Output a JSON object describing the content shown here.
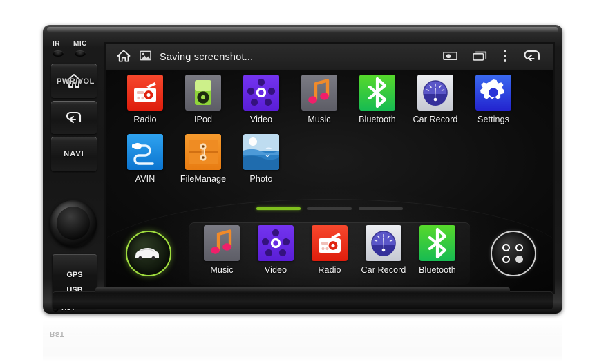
{
  "device": {
    "sensors": [
      {
        "label": "IR"
      },
      {
        "label": "MIC"
      }
    ],
    "buttons": [
      {
        "name": "home",
        "label": "",
        "icon": "home-icon"
      },
      {
        "name": "back",
        "label": "",
        "icon": "back-arrow-icon"
      },
      {
        "name": "navi",
        "label": "NAVI",
        "icon": ""
      }
    ],
    "knob_label": "PWR/VOL",
    "slot_labels": [
      "GPS",
      "USB"
    ],
    "reset_label": "RST"
  },
  "statusbar": {
    "home_icon": "home-icon",
    "notification_icon": "image-icon",
    "message": "Saving screenshot...",
    "right_icons": [
      {
        "name": "screenshot-icon"
      },
      {
        "name": "recent-apps-icon"
      },
      {
        "name": "overflow-menu-icon"
      },
      {
        "name": "back-arrow-icon"
      }
    ]
  },
  "home": {
    "apps_row1": [
      {
        "label": "Radio",
        "icon": "radio-icon",
        "color": "#ee2d1a"
      },
      {
        "label": "IPod",
        "icon": "ipod-icon",
        "color": "#6b6b73"
      },
      {
        "label": "Video",
        "icon": "video-icon",
        "color": "#6526e8"
      },
      {
        "label": "Music",
        "icon": "music-note-icon",
        "color": "#6b6b73"
      },
      {
        "label": "Bluetooth",
        "icon": "bluetooth-icon",
        "color": "#2ecc2e"
      },
      {
        "label": "Car Record",
        "icon": "gauge-icon",
        "color": "#d6d8de"
      },
      {
        "label": "Settings",
        "icon": "gear-icon",
        "color": "#2b49e0"
      }
    ],
    "apps_row2": [
      {
        "label": "AVIN",
        "icon": "avin-plug-icon",
        "color": "#1b8ae0"
      },
      {
        "label": "FileManage",
        "icon": "folder-icon",
        "color": "#ef8c23"
      },
      {
        "label": "Photo",
        "icon": "photo-icon",
        "color": "#2f84c8"
      }
    ],
    "pager": {
      "pages": 3,
      "active": 1
    },
    "dock": {
      "car_button": "car-icon",
      "apps": [
        {
          "label": "Music",
          "icon": "music-note-icon",
          "color": "#6b6b73"
        },
        {
          "label": "Video",
          "icon": "video-icon",
          "color": "#6526e8"
        },
        {
          "label": "Radio",
          "icon": "radio-icon",
          "color": "#ee2d1a"
        },
        {
          "label": "Car Record",
          "icon": "gauge-icon",
          "color": "#d6d8de"
        },
        {
          "label": "Bluetooth",
          "icon": "bluetooth-icon",
          "color": "#2ecc2e"
        }
      ],
      "drawer_button": "app-drawer-icon"
    }
  },
  "colors": {
    "accent_green": "#7fc01e",
    "screen_bg": "#060606",
    "statusbar_bg": "#242424"
  }
}
